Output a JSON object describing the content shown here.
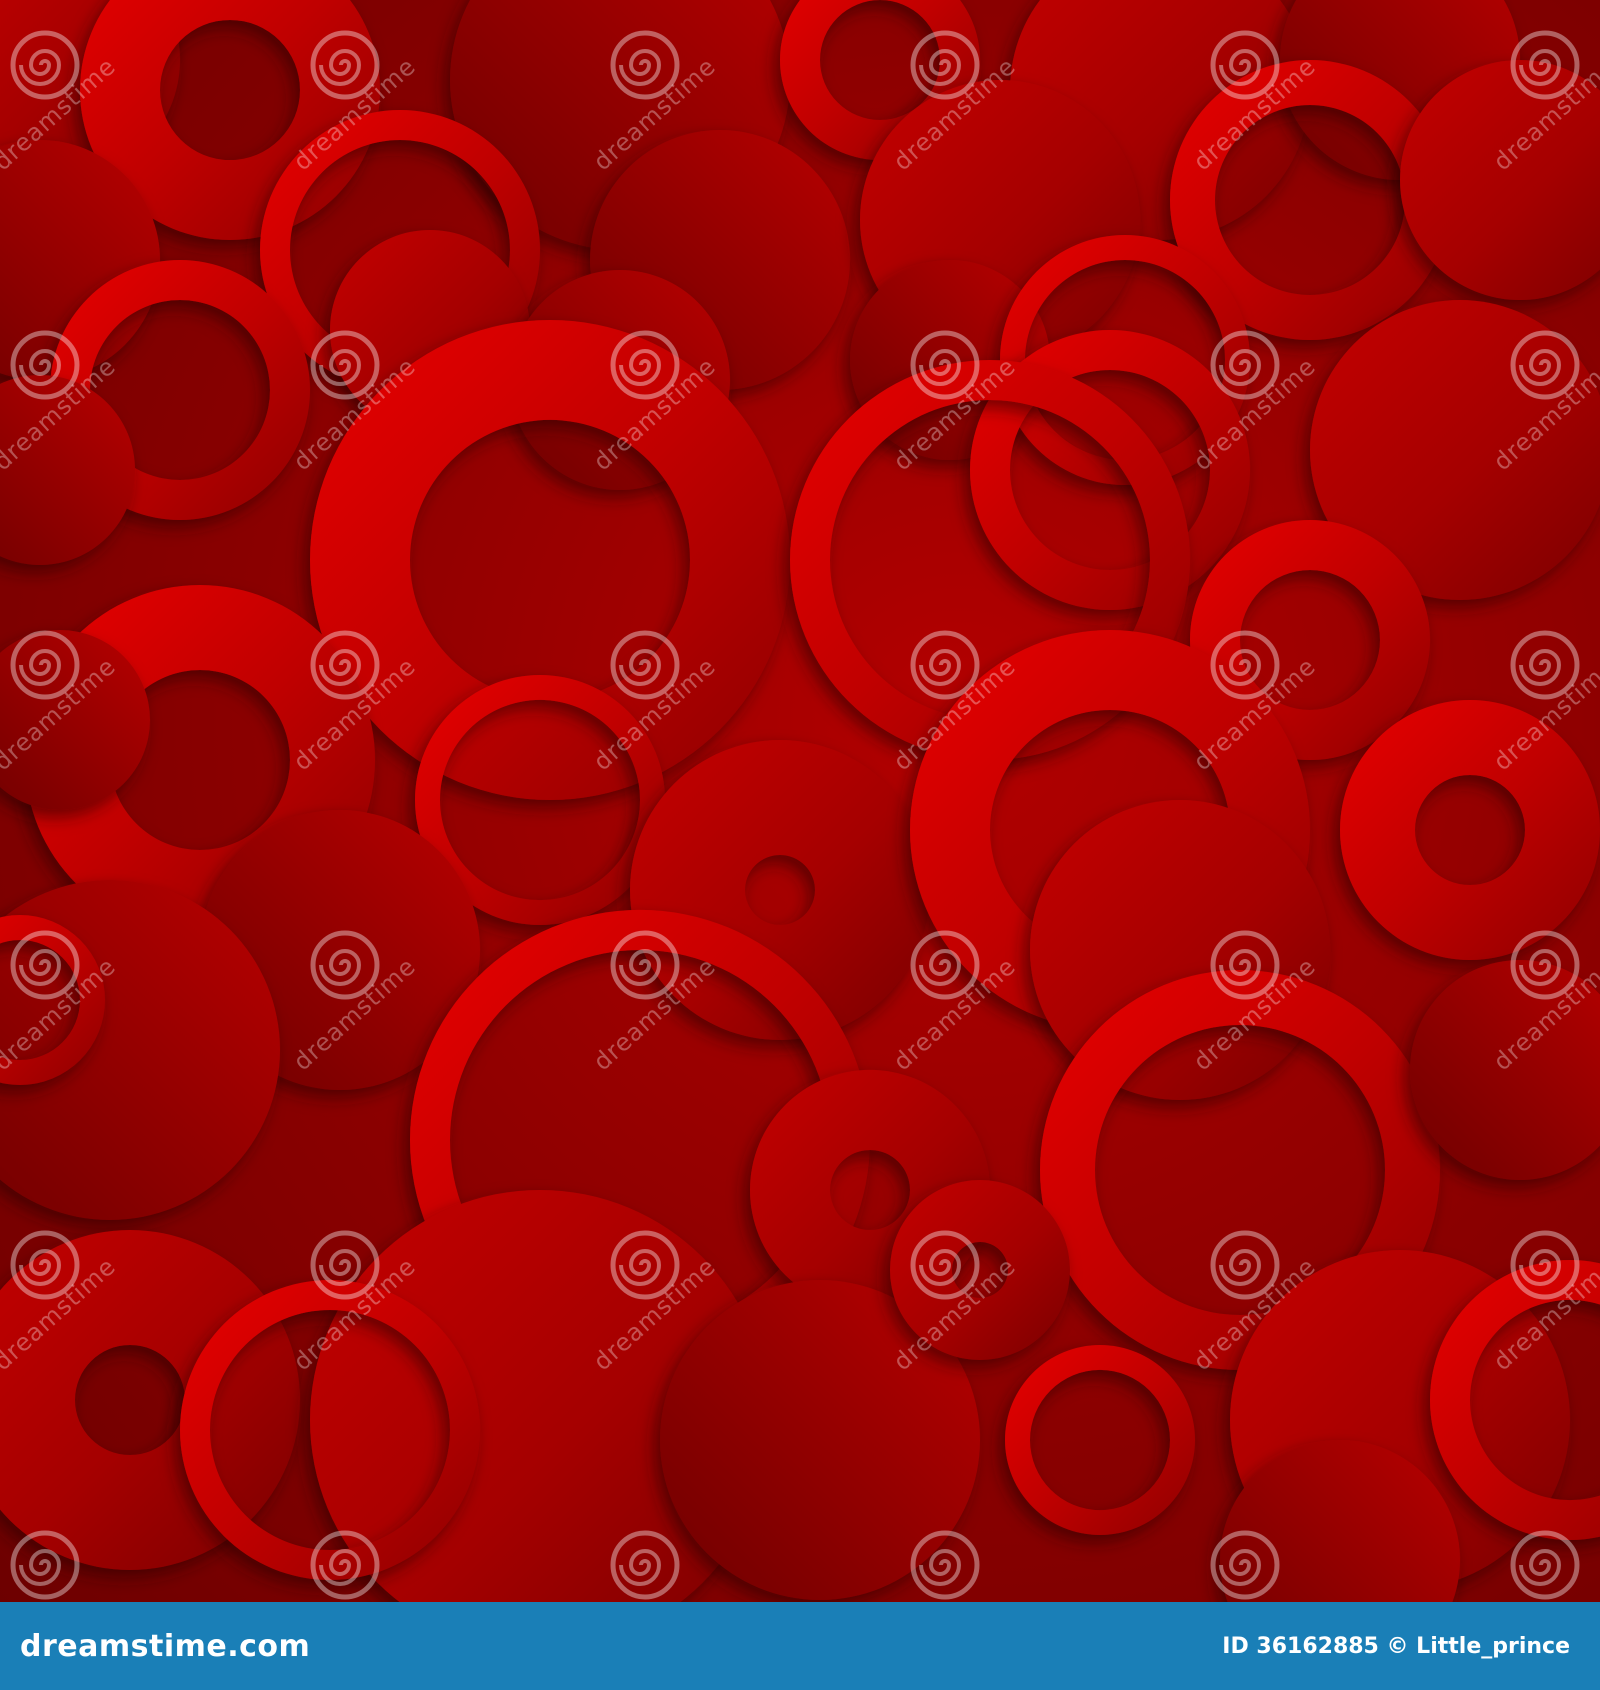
{
  "colors": {
    "background": "#8a0000",
    "light_red": "#e60000",
    "dark_red": "#5e0000",
    "footer_bar": "#1a7fb7",
    "footer_text": "#ffffff"
  },
  "watermark": {
    "text": "dreamstime",
    "icon": "spiral-logo-icon"
  },
  "footer": {
    "brand": "dreamstime.com",
    "stock_id": "ID 36162885 © Little_prince"
  }
}
